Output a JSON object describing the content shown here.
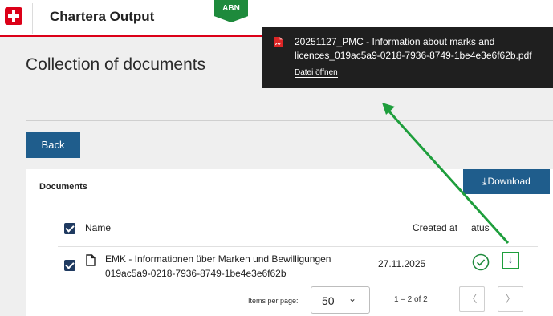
{
  "header": {
    "app_title": "Chartera Output",
    "env_badge": "ABN"
  },
  "page": {
    "title": "Collection of documents",
    "back_label": "Back"
  },
  "documents": {
    "title": "Documents",
    "download_label": "Download",
    "columns": {
      "name": "Name",
      "created_at": "Created at",
      "status": "atus"
    },
    "rows": [
      {
        "name_line1": "EMK - Informationen über Marken und Bewilligungen",
        "name_line2": "019ac5a9-0218-7936-8749-1be4e3e6f62b",
        "created_at": "27.11.2025",
        "status": "check-circle-icon"
      }
    ]
  },
  "pagination": {
    "items_per_page_label": "Items per page:",
    "items_per_page_value": "50",
    "range_label": "1 – 2 of 2",
    "prev_glyph": "〈",
    "next_glyph": "〉"
  },
  "download_popup": {
    "file_line1": "20251127_PMC - Information about marks and",
    "file_line2": "licences_019ac5a9-0218-7936-8749-1be4e3e6f62b.pdf",
    "open_link": "Datei öffnen"
  },
  "colors": {
    "accent_red": "#dc0018",
    "primary_blue": "#1f5d8c",
    "checkbox_navy": "#1f3a60",
    "annotation_green": "#1e9e3c",
    "badge_green": "#1e8a3c",
    "popup_bg": "#1f1f1f"
  }
}
